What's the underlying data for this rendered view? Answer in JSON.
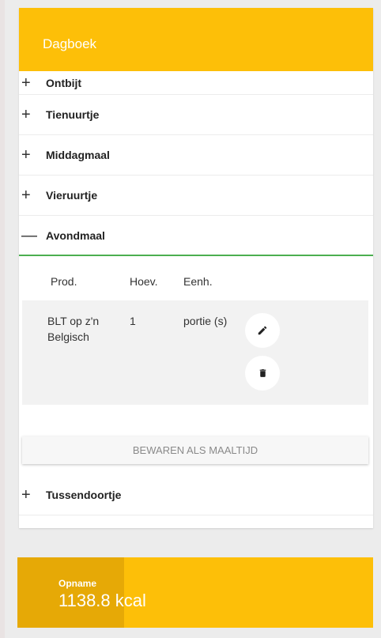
{
  "diary": {
    "title": "Dagboek",
    "meals": [
      {
        "label": "Ontbijt",
        "toggle": "+"
      },
      {
        "label": "Tienuurtje",
        "toggle": "+"
      },
      {
        "label": "Middagmaal",
        "toggle": "+"
      },
      {
        "label": "Vieruurtje",
        "toggle": "+"
      },
      {
        "label": "Avondmaal",
        "toggle": "—"
      },
      {
        "label": "Tussendoortje",
        "toggle": "+"
      }
    ],
    "table": {
      "headers": [
        "Prod.",
        "Hoev.",
        "Eenh."
      ],
      "rows": [
        {
          "product": "BLT op z'n Belgisch",
          "amount": "1",
          "unit": "portie (s)"
        }
      ]
    },
    "save_meal_label": "BEWAREN ALS MAALTIJD"
  },
  "intake": {
    "label": "Opname",
    "value": "1138.8 kcal",
    "progress_fraction": 0.3
  },
  "colors": {
    "accent": "#fdbf08",
    "accent_dark": "#e6a906",
    "open_underline": "#4caf50"
  }
}
